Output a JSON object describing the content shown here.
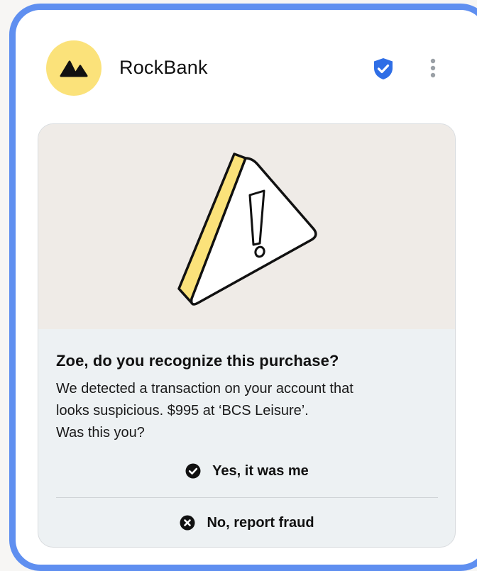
{
  "app": {
    "name": "RockBank"
  },
  "colors": {
    "frame": "#5f8ff0",
    "logo_bg": "#fbe27a",
    "verified": "#2f6ee6",
    "illustration_bg": "#efebe7",
    "card_bg": "#edf1f3"
  },
  "icons": {
    "logo": "mountain-logo-icon",
    "verified": "shield-check-icon",
    "more": "more-vertical-icon",
    "illustration": "warning-triangle-illustration",
    "confirm": "check-circle-icon",
    "reject": "x-circle-icon"
  },
  "alert": {
    "title": "Zoe, do you recognize this purchase?",
    "body_lines": [
      "We detected a transaction on your account that",
      "looks suspicious. $995 at ‘BCS Leisure’.",
      "Was this you?"
    ],
    "confirm_label": "Yes, it was me",
    "reject_label": "No, report fraud"
  }
}
